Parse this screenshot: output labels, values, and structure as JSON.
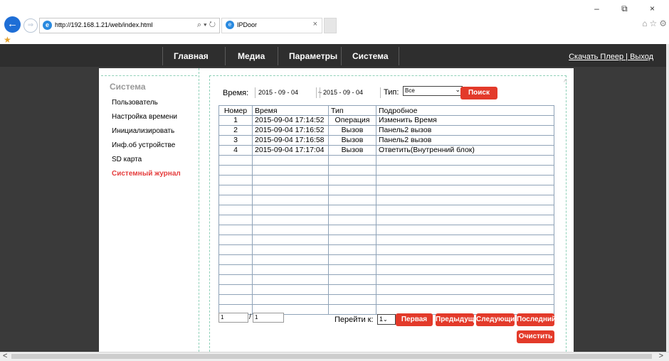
{
  "browser": {
    "url": "http://192.168.1.21/web/index.html",
    "tab_title": "IPDoor",
    "back_glyph": "←",
    "forward_glyph": "⇒",
    "addr_tools": "⌕ ▾ ↻",
    "tab_close": "×",
    "window_controls": "– ⧉ ×",
    "right_icons": "⌂☆⚙"
  },
  "nav": {
    "items": [
      "Главная",
      "Медиа",
      "Параметры",
      "Система"
    ],
    "download_player": "Скачать Плеер",
    "separator": "|",
    "logout": "Выход"
  },
  "sidebar": {
    "title": "Система",
    "items": [
      "Пользователь",
      "Настройка времени",
      "Инициализировать",
      "Инф.об устройстве",
      "SD карта",
      "Системный журнал"
    ],
    "active_index": 5
  },
  "filter": {
    "time_label": "Время:",
    "date_from": "2015  -  09  -  04",
    "tilde": "~",
    "date_to": "2015  -  09  -  04",
    "type_label": "Тип:",
    "type_value": "Все",
    "search_button": "Поиск"
  },
  "table": {
    "headers": [
      "Номер",
      "Время",
      "Тип",
      "Подробное"
    ],
    "rows": [
      [
        "1",
        "2015-09-04 17:14:52",
        "Операция",
        "Изменить Время"
      ],
      [
        "2",
        "2015-09-04 17:16:52",
        "Вызов",
        "Панель2 вызов"
      ],
      [
        "3",
        "2015-09-04 17:16:58",
        "Вызов",
        "Панель2 вызов"
      ],
      [
        "4",
        "2015-09-04 17:17:04",
        "Вызов",
        "Ответить(Внутренний блок)"
      ]
    ],
    "empty_rows": 16
  },
  "pagination": {
    "current_page": "1",
    "slash": "/",
    "total_pages": "1",
    "goto_label": "Перейти к:",
    "goto_value": "1",
    "first": "Первая",
    "prev": "Предыдущ",
    "next": "Следующи",
    "last": "Последний",
    "clear": "Очистить"
  },
  "scrollbar": {
    "left": "<",
    "right": ">",
    "up": "^"
  },
  "colors": {
    "accent_red": "#e33a2a",
    "active_red": "#e53d3d",
    "nav_bg": "#2e2e2e",
    "page_bg": "#3a3a3a",
    "dashed_border": "#8fd0b8"
  }
}
